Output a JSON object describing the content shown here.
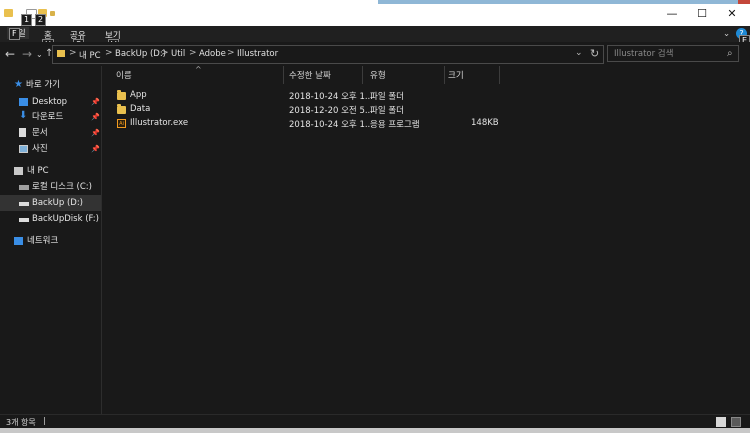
{
  "window": {
    "minimize": "—",
    "maximize": "☐",
    "close": "✕"
  },
  "keytips": {
    "file": "F",
    "quick1": "1",
    "quick2": "2",
    "home": "H",
    "share": "S",
    "view": "V",
    "help": "E"
  },
  "ribbon": {
    "tabs": [
      {
        "label": "파일"
      },
      {
        "label": "홈"
      },
      {
        "label": "공유"
      },
      {
        "label": "보기"
      }
    ]
  },
  "address": {
    "crumbs": [
      "내 PC",
      "BackUp (D:)",
      "Util",
      "Adobe",
      "Illustrator"
    ],
    "separator": ">"
  },
  "search": {
    "placeholder": "Illustrator 검색"
  },
  "sidebar": {
    "quick_access": "바로 가기",
    "pinned": [
      {
        "label": "Desktop"
      },
      {
        "label": "다운로드"
      },
      {
        "label": "문서"
      },
      {
        "label": "사진"
      }
    ],
    "this_pc": "내 PC",
    "drives": [
      {
        "label": "로컬 디스크 (C:)"
      },
      {
        "label": "BackUp (D:)"
      },
      {
        "label": "BackUpDisk (F:)"
      }
    ],
    "network": "네트워크"
  },
  "list": {
    "columns": [
      "이름",
      "수정한 날짜",
      "유형",
      "크기"
    ],
    "rows": [
      {
        "name": "App",
        "date": "2018-10-24 오후 1...",
        "type": "파일 폴더",
        "size": ""
      },
      {
        "name": "Data",
        "date": "2018-12-20 오전 5...",
        "type": "파일 폴더",
        "size": ""
      },
      {
        "name": "Illustrator.exe",
        "date": "2018-10-24 오후 1...",
        "type": "응용 프로그램",
        "size": "148KB"
      }
    ]
  },
  "status": {
    "item_count": "3개 항목",
    "cursor": "|"
  },
  "icons": {
    "folder": "folder-icon",
    "app": "illustrator-app-icon",
    "star": "star-icon",
    "desktop": "desktop-icon",
    "download": "download-icon",
    "docs": "document-icon",
    "pictures": "pictures-icon",
    "pc": "pc-icon",
    "drive": "drive-icon",
    "network": "network-icon"
  },
  "colors": {
    "accent": "#1e8ad6",
    "folder": "#e9c04e",
    "selected": "#333333",
    "background": "#191919"
  }
}
